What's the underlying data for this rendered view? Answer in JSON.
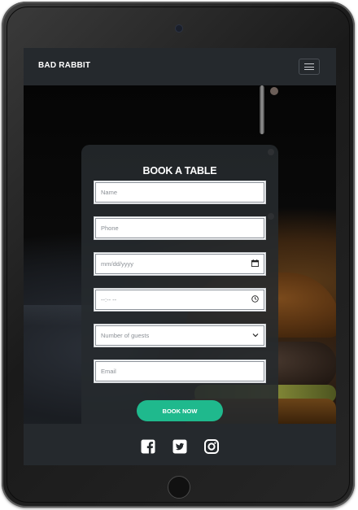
{
  "navbar": {
    "brand": "BAD RABBIT",
    "menu_icon": "hamburger-menu-icon"
  },
  "form": {
    "title": "BOOK A TABLE",
    "name_placeholder": "Name",
    "phone_placeholder": "Phone",
    "date_placeholder": "mm/dd/yyyy",
    "time_placeholder": "--:-- --",
    "guests_placeholder": "Number of guests",
    "email_placeholder": "Email",
    "submit_label": "BOOK NOW",
    "date_icon": "calendar-icon",
    "time_icon": "clock-icon",
    "guests_icon": "chevron-down-icon"
  },
  "footer": {
    "social_icons": [
      "facebook-icon",
      "twitter-icon",
      "instagram-icon"
    ]
  },
  "colors": {
    "accent": "#1fb98d",
    "navbar": "#25292d",
    "card": "#262a2e"
  }
}
